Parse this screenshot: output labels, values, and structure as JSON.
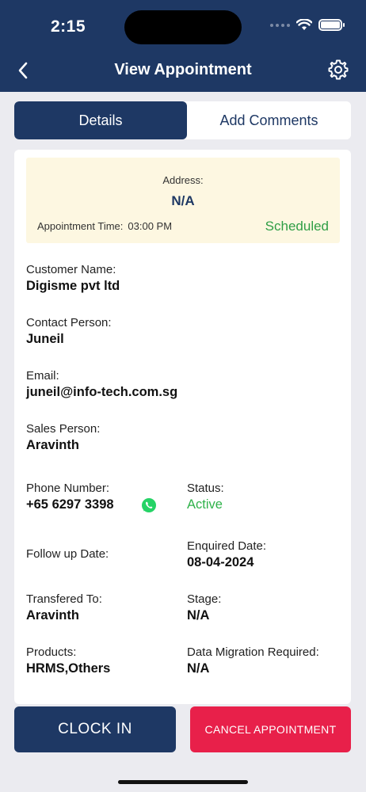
{
  "status_bar": {
    "time": "2:15"
  },
  "nav": {
    "title": "View Appointment"
  },
  "tabs": [
    {
      "label": "Details",
      "active": true
    },
    {
      "label": "Add Comments",
      "active": false
    }
  ],
  "summary": {
    "address_label": "Address:",
    "address_value": "N/A",
    "appointment_time_label": "Appointment Time:",
    "appointment_time_value": "03:00 PM",
    "status": "Scheduled"
  },
  "fields": {
    "customer_name": {
      "label": "Customer Name:",
      "value": "Digisme pvt ltd"
    },
    "contact_person": {
      "label": "Contact Person:",
      "value": "Juneil"
    },
    "email": {
      "label": "Email:",
      "value": "juneil@info-tech.com.sg"
    },
    "sales_person": {
      "label": "Sales Person:",
      "value": "Aravinth"
    },
    "phone_number": {
      "label": "Phone Number:",
      "value": "+65 6297 3398"
    },
    "status": {
      "label": "Status:",
      "value": "Active"
    },
    "follow_up_date": {
      "label": "Follow up Date:",
      "value": ""
    },
    "enquired_date": {
      "label": "Enquired Date:",
      "value": "08-04-2024"
    },
    "transfered_to": {
      "label": "Transfered To:",
      "value": "Aravinth"
    },
    "stage": {
      "label": "Stage:",
      "value": "N/A"
    },
    "products": {
      "label": "Products:",
      "value": "HRMS,Others"
    },
    "data_migration": {
      "label": "Data Migration Required:",
      "value": "N/A"
    }
  },
  "buttons": {
    "clock_in": "CLOCK IN",
    "cancel_appointment": "CANCEL APPOINTMENT"
  },
  "colors": {
    "primary": "#1e3864",
    "danger": "#e8204a",
    "success": "#2f9e45",
    "summary_bg": "#fdf7e1"
  }
}
